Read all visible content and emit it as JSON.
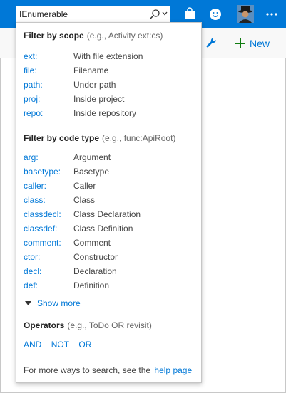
{
  "colors": {
    "accent": "#0078d7",
    "link": "#0078d7",
    "topbar": "#0078d7",
    "plus": "#107c10"
  },
  "search": {
    "value": "IEnumerable"
  },
  "header": {
    "icons": [
      "search-icon",
      "chevron-down-icon",
      "shopping-bag-icon",
      "smiley-icon",
      "avatar",
      "more-icon"
    ],
    "new_label": "New"
  },
  "scope": {
    "title": "Filter by scope",
    "hint": "(e.g., Activity ext:cs)",
    "items": [
      {
        "key": "ext:",
        "desc": "With file extension"
      },
      {
        "key": "file:",
        "desc": "Filename"
      },
      {
        "key": "path:",
        "desc": "Under path"
      },
      {
        "key": "proj:",
        "desc": "Inside project"
      },
      {
        "key": "repo:",
        "desc": "Inside repository"
      }
    ]
  },
  "codetype": {
    "title": "Filter by code type",
    "hint": "(e.g., func:ApiRoot)",
    "items": [
      {
        "key": "arg:",
        "desc": "Argument"
      },
      {
        "key": "basetype:",
        "desc": "Basetype"
      },
      {
        "key": "caller:",
        "desc": "Caller"
      },
      {
        "key": "class:",
        "desc": "Class"
      },
      {
        "key": "classdecl:",
        "desc": "Class Declaration"
      },
      {
        "key": "classdef:",
        "desc": "Class Definition"
      },
      {
        "key": "comment:",
        "desc": "Comment"
      },
      {
        "key": "ctor:",
        "desc": "Constructor"
      },
      {
        "key": "decl:",
        "desc": "Declaration"
      },
      {
        "key": "def:",
        "desc": "Definition"
      }
    ],
    "show_more": "Show more"
  },
  "operators": {
    "title": "Operators",
    "hint": "(e.g., ToDo OR revisit)",
    "items": [
      "AND",
      "NOT",
      "OR"
    ]
  },
  "footer": {
    "text": "For more ways to search, see the",
    "link": "help page"
  }
}
